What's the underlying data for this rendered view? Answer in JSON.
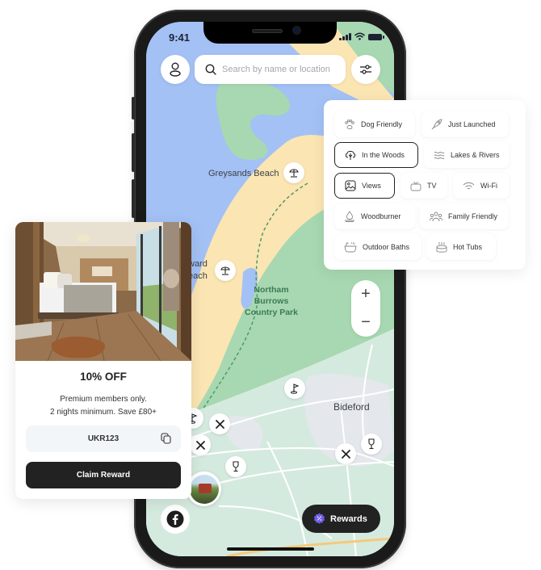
{
  "status_bar": {
    "time": "9:41"
  },
  "search": {
    "placeholder": "Search by name or location",
    "value": ""
  },
  "map": {
    "labels": {
      "greysands": "Greysands Beach",
      "westward_line1": "ward",
      "westward_line2": "each",
      "park_line1": "Northam",
      "park_line2": "Burrows",
      "park_line3": "Country Park",
      "town": "Bideford"
    },
    "pins": [
      {
        "type": "beach-icon",
        "place": "Greysands Beach"
      },
      {
        "type": "beach-icon",
        "place": "Westward Ho! Beach"
      },
      {
        "type": "golf-icon"
      },
      {
        "type": "golf-icon"
      },
      {
        "type": "restaurant-icon"
      },
      {
        "type": "restaurant-icon"
      },
      {
        "type": "restaurant-icon"
      },
      {
        "type": "wine-icon"
      },
      {
        "type": "wine-icon"
      },
      {
        "type": "property-photo"
      }
    ],
    "zoom_in": "+",
    "zoom_out": "−",
    "colors": {
      "water": "#a3c1f5",
      "sand": "#fbe5b3",
      "park": "#a7d8b1",
      "land": "#d7ebe0",
      "town": "#e6e9ee",
      "road": "#ffffff"
    }
  },
  "rewards_button": {
    "label": "Rewards",
    "accent": "#6e5de8"
  },
  "filters": {
    "chips": [
      {
        "label": "Dog Friendly",
        "icon": "paw-icon",
        "selected": false
      },
      {
        "label": "Just Launched",
        "icon": "rocket-icon",
        "selected": false
      },
      {
        "label": "In the Woods",
        "icon": "tree-icon",
        "selected": true
      },
      {
        "label": "Lakes & Rivers",
        "icon": "waves-icon",
        "selected": false
      },
      {
        "label": "Views",
        "icon": "image-icon",
        "selected": true
      },
      {
        "label": "TV",
        "icon": "tv-icon",
        "selected": false
      },
      {
        "label": "Wi-Fi",
        "icon": "wifi-icon",
        "selected": false
      },
      {
        "label": "Woodburner",
        "icon": "fire-icon",
        "selected": false
      },
      {
        "label": "Family Friendly",
        "icon": "family-icon",
        "selected": false
      },
      {
        "label": "Outdoor Baths",
        "icon": "bath-icon",
        "selected": false
      },
      {
        "label": "Hot Tubs",
        "icon": "hot-tub-icon",
        "selected": false
      }
    ]
  },
  "reward_card": {
    "title": "10% OFF",
    "desc_line1": "Premium members only.",
    "desc_line2": "2 nights minimum. Save £80+",
    "code": "UKR123",
    "claim_label": "Claim Reward"
  }
}
